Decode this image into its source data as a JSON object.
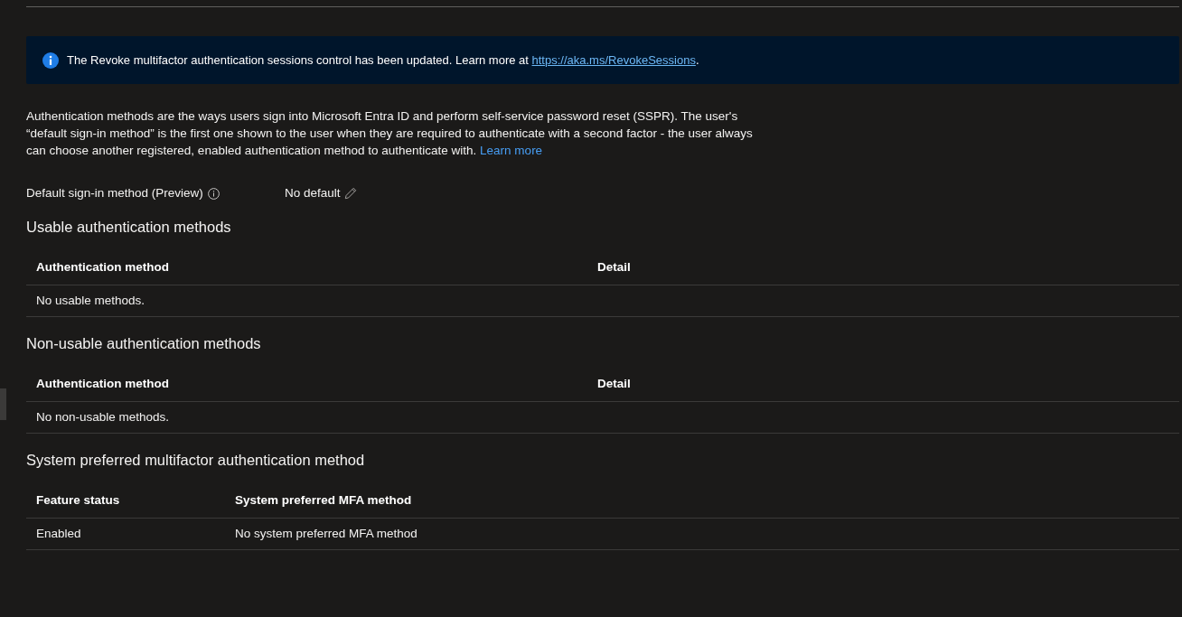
{
  "notice": {
    "text": "The Revoke multifactor authentication sessions control has been updated. Learn more at ",
    "link": "https://aka.ms/RevokeSessions",
    "suffix": "."
  },
  "description": {
    "text": "Authentication methods are the ways users sign into Microsoft Entra ID and perform self-service password reset (SSPR). The user's “default sign-in method” is the first one shown to the user when they are required to authenticate with a second factor - the user always can choose another registered, enabled authentication method to authenticate with.",
    "link": "Learn more"
  },
  "default_sign_in": {
    "label": "Default sign-in method (Preview)",
    "value": "No default"
  },
  "sections": [
    {
      "title": "Usable authentication methods",
      "table": {
        "columns": [
          "Authentication method",
          "Detail"
        ],
        "empty_message": "No usable methods."
      }
    },
    {
      "title": "Non-usable authentication methods",
      "table": {
        "columns": [
          "Authentication method",
          "Detail"
        ],
        "empty_message": "No non-usable methods."
      }
    },
    {
      "title": "System preferred multifactor authentication method",
      "table": {
        "columns": [
          "Feature status",
          "System preferred MFA method"
        ],
        "rows": [
          [
            "Enabled",
            "No system preferred MFA method"
          ]
        ]
      }
    }
  ]
}
